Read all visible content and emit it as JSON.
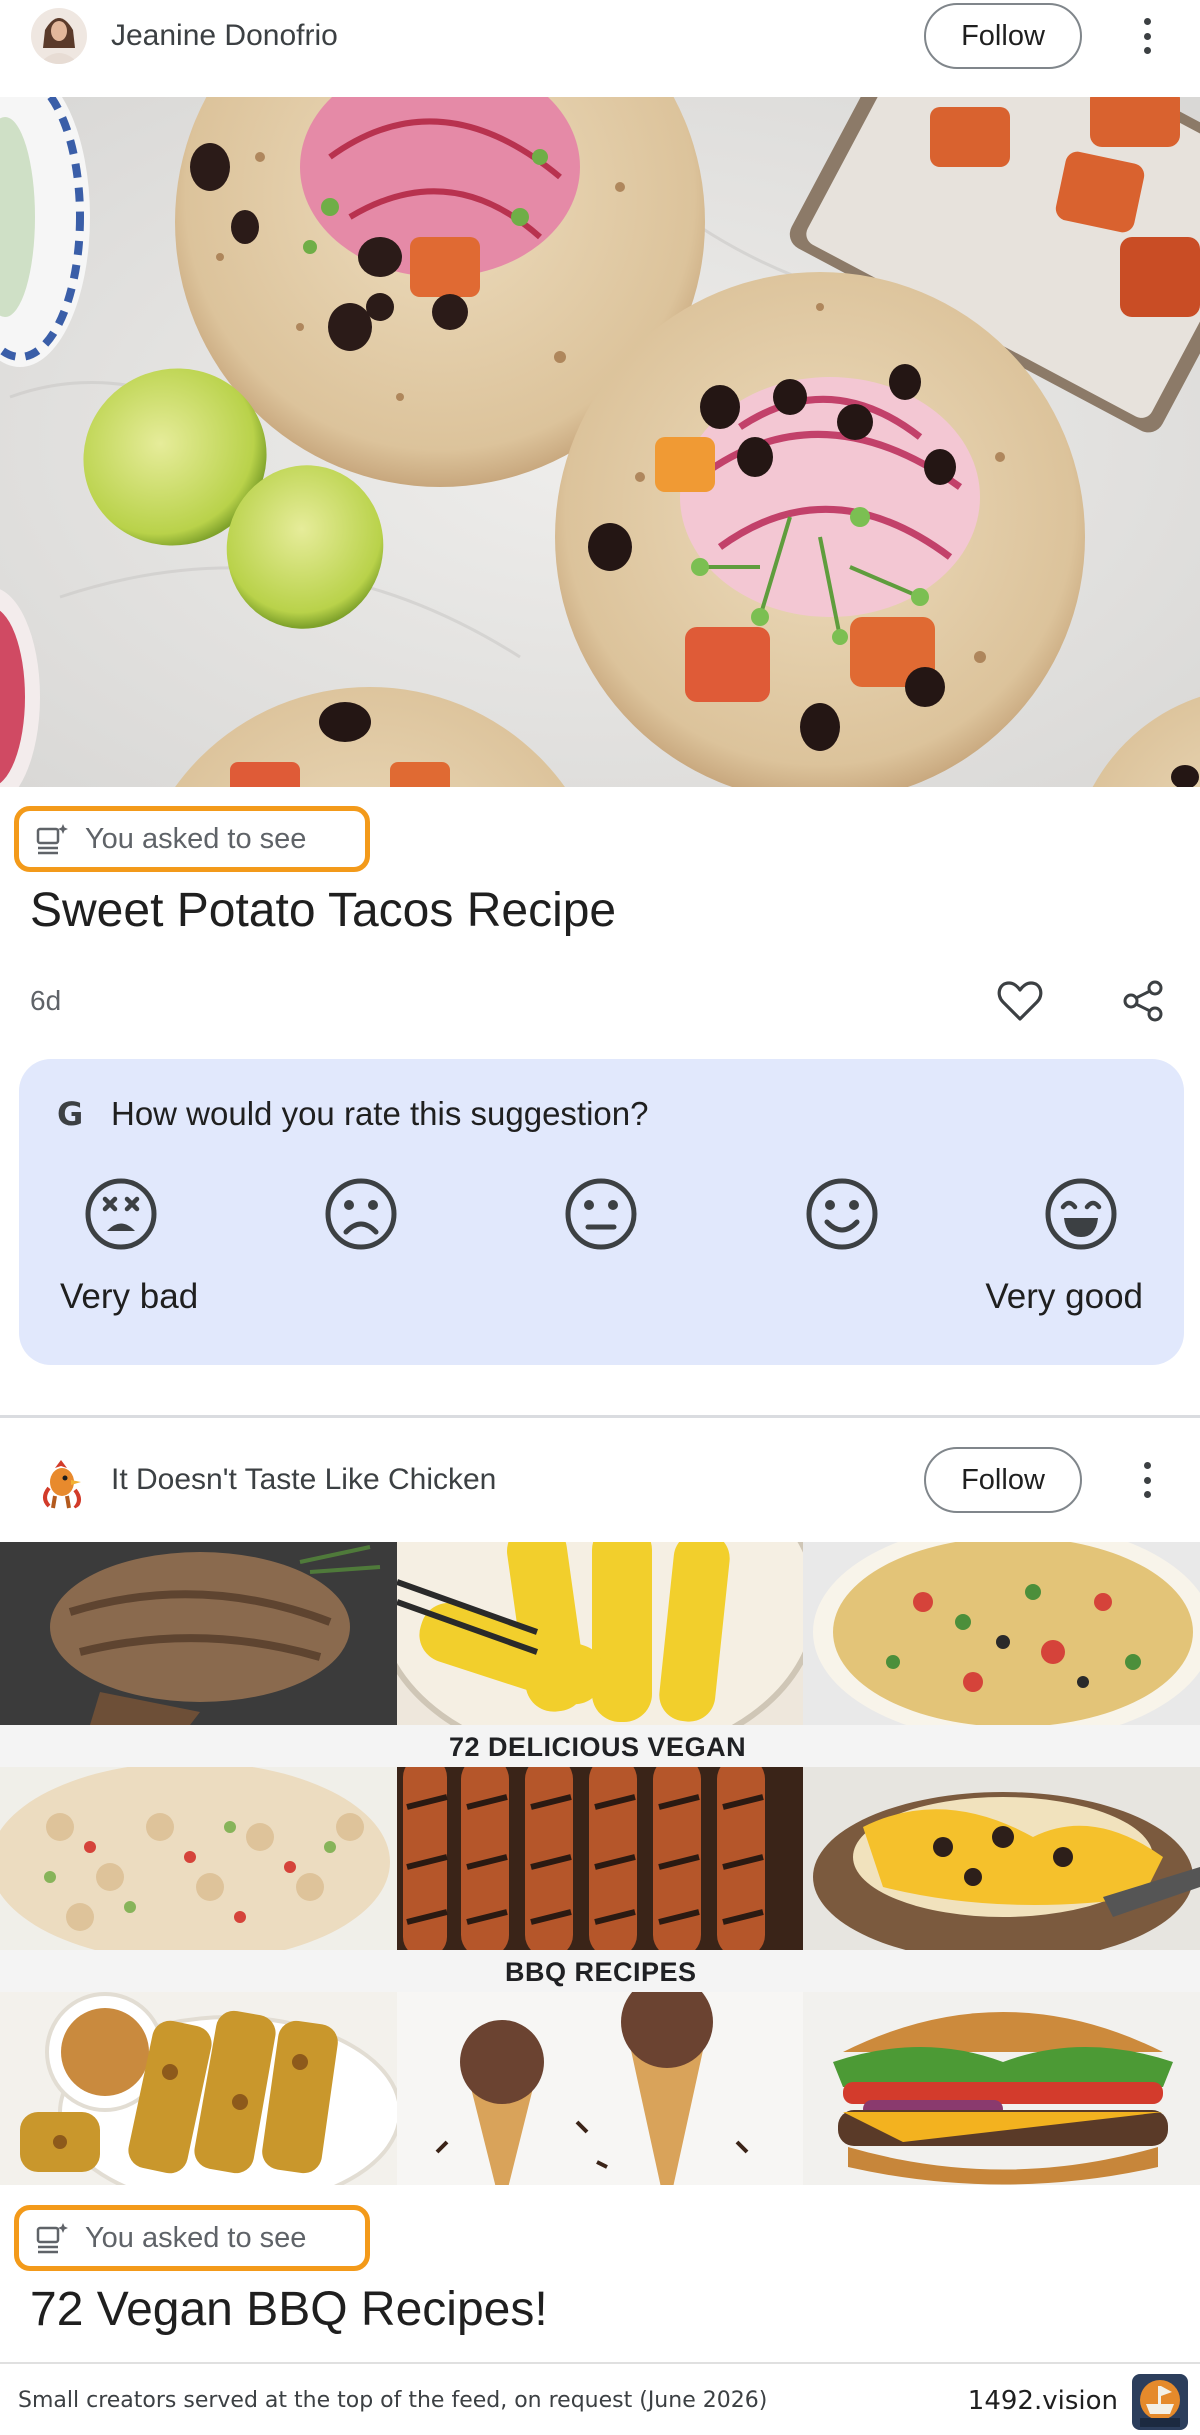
{
  "post1": {
    "author": "Jeanine Donofrio",
    "follow_label": "Follow",
    "badge": "You asked to see",
    "title": "Sweet Potato Tacos Recipe",
    "age": "6d",
    "actions": [
      "heart-icon",
      "share-icon"
    ]
  },
  "rating": {
    "question": "How would you rate this suggestion?",
    "g_letter": "G",
    "low_label": "Very bad",
    "high_label": "Very good",
    "faces": [
      "very-bad-face-icon",
      "bad-face-icon",
      "neutral-face-icon",
      "good-face-icon",
      "very-good-face-icon"
    ]
  },
  "post2": {
    "author": "It Doesn't Taste Like Chicken",
    "follow_label": "Follow",
    "collage_line1": "72 DELICIOUS VEGAN",
    "collage_line2": "BBQ RECIPES",
    "badge": "You asked to see",
    "title": "72 Vegan BBQ Recipes!"
  },
  "footer": {
    "caption": "Small creators served at the top of the feed, on request (June 2026)",
    "brand": "1492.vision"
  },
  "colors": {
    "highlight": "#f39a1a",
    "rating_bg": "#e1e8fc"
  }
}
